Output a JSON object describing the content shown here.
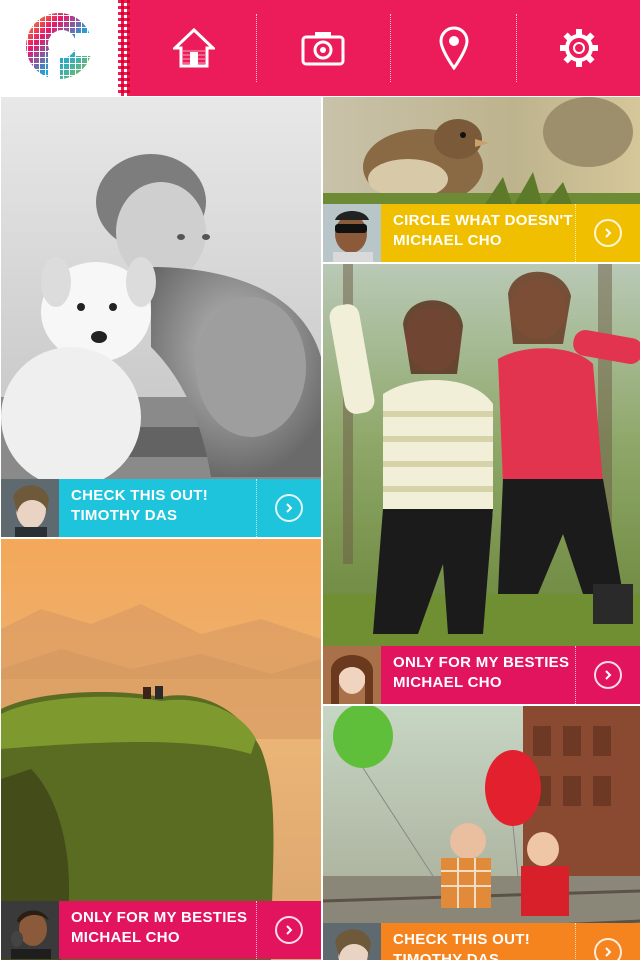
{
  "header": {
    "logo": "pixel-p-logo",
    "nav": [
      {
        "icon": "home-icon"
      },
      {
        "icon": "camera-icon"
      },
      {
        "icon": "location-pin-icon"
      },
      {
        "icon": "gear-icon"
      }
    ],
    "accent": "#ec1c5b"
  },
  "feed": [
    {
      "title": "CHECK THIS OUT!",
      "author": "TIMOTHY DAS",
      "color": "#1ec3dc",
      "photo": "boy-with-puppy-photo"
    },
    {
      "title": "ONLY FOR MY BESTIES",
      "author": "MICHAEL CHO",
      "color": "#e2145e",
      "photo": "sunset-rock-photo"
    },
    {
      "title": "CIRCLE WHAT DOESN'T",
      "author": "MICHAEL CHO",
      "color": "#f0c000",
      "photo": "sparrows-photo"
    },
    {
      "title": "ONLY FOR MY BESTIES",
      "author": "MICHAEL CHO",
      "color": "#e2145e",
      "photo": "jumping-girls-photo"
    },
    {
      "title": "CHECK THIS OUT!",
      "author": "TIMOTHY DAS",
      "color": "#f5841f",
      "photo": "kids-balloons-photo"
    }
  ]
}
